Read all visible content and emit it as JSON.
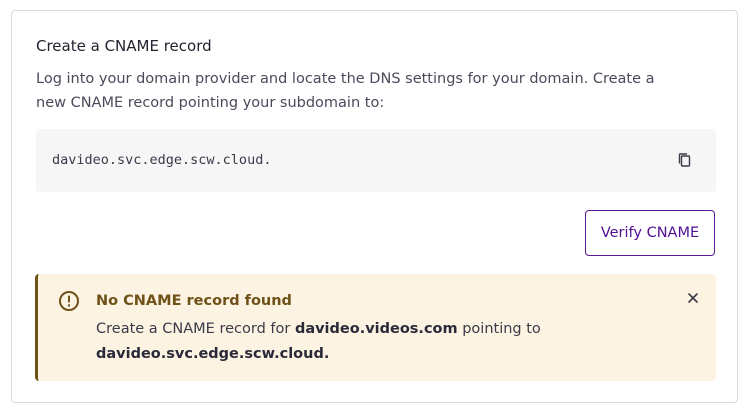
{
  "section": {
    "title": "Create a CNAME record",
    "description": "Log into your domain provider and locate the DNS settings for your domain. Create a new CNAME record pointing your subdomain to:"
  },
  "cname": {
    "target": "davideo.svc.edge.scw.cloud.",
    "copy_icon": "copy-icon"
  },
  "verify_button": {
    "label": "Verify CNAME"
  },
  "alert": {
    "icon": "warning-circle-icon",
    "title": "No CNAME record found",
    "body_prefix": "Create a CNAME record for ",
    "domain": "davideo.videos.com",
    "body_middle": " pointing to ",
    "target": "davideo.svc.edge.scw.cloud.",
    "close_icon": "close-icon"
  },
  "colors": {
    "accent": "#521094",
    "warning_text": "#6e5218",
    "warning_bg": "#fdf3e3",
    "code_bg": "#f6f6f7"
  }
}
